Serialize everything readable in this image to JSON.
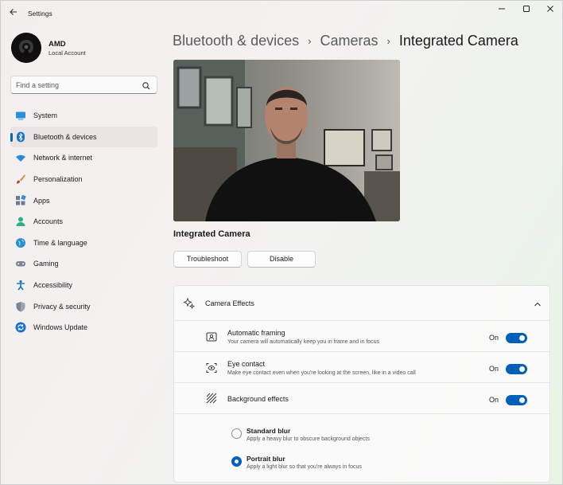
{
  "window": {
    "title": "Settings",
    "icons": {
      "back": "back-arrow-icon",
      "minimize": "minimize-icon",
      "maximize": "maximize-icon",
      "close": "close-icon"
    }
  },
  "user": {
    "name": "AMD",
    "account_type": "Local Account"
  },
  "search": {
    "placeholder": "Find a setting",
    "icon": "search-icon"
  },
  "nav": {
    "items": [
      {
        "label": "System",
        "icon": "monitor-icon",
        "active": false
      },
      {
        "label": "Bluetooth & devices",
        "icon": "bluetooth-icon",
        "active": true
      },
      {
        "label": "Network & internet",
        "icon": "wifi-icon",
        "active": false
      },
      {
        "label": "Personalization",
        "icon": "brush-icon",
        "active": false
      },
      {
        "label": "Apps",
        "icon": "apps-icon",
        "active": false
      },
      {
        "label": "Accounts",
        "icon": "person-icon",
        "active": false
      },
      {
        "label": "Time & language",
        "icon": "globe-icon",
        "active": false
      },
      {
        "label": "Gaming",
        "icon": "gamepad-icon",
        "active": false
      },
      {
        "label": "Accessibility",
        "icon": "accessibility-icon",
        "active": false
      },
      {
        "label": "Privacy & security",
        "icon": "shield-icon",
        "active": false
      },
      {
        "label": "Windows Update",
        "icon": "update-icon",
        "active": false
      }
    ]
  },
  "breadcrumb": [
    "Bluetooth & devices",
    "Cameras",
    "Integrated Camera"
  ],
  "camera": {
    "name": "Integrated Camera"
  },
  "actions": {
    "troubleshoot": "Troubleshoot",
    "disable": "Disable"
  },
  "effects": {
    "title": "Camera Effects",
    "expanded": true,
    "rows": [
      {
        "title": "Automatic framing",
        "subtitle": "Your camera will automatically keep you in frame and in focus",
        "state": "On",
        "icon": "framing-icon"
      },
      {
        "title": "Eye contact",
        "subtitle": "Make eye contact even when you're looking at the screen, like in a video call",
        "state": "On",
        "icon": "eye-contact-icon"
      },
      {
        "title": "Background effects",
        "subtitle": "",
        "state": "On",
        "icon": "background-effects-icon"
      }
    ],
    "blur_options": [
      {
        "title": "Standard blur",
        "subtitle": "Apply a heavy blur to obscure background objects",
        "selected": false
      },
      {
        "title": "Portrait blur",
        "subtitle": "Apply a light blur so that you're always in focus",
        "selected": true
      }
    ]
  },
  "colors": {
    "accent": "#005fb8",
    "selection_bg": "#ebe4e4"
  }
}
